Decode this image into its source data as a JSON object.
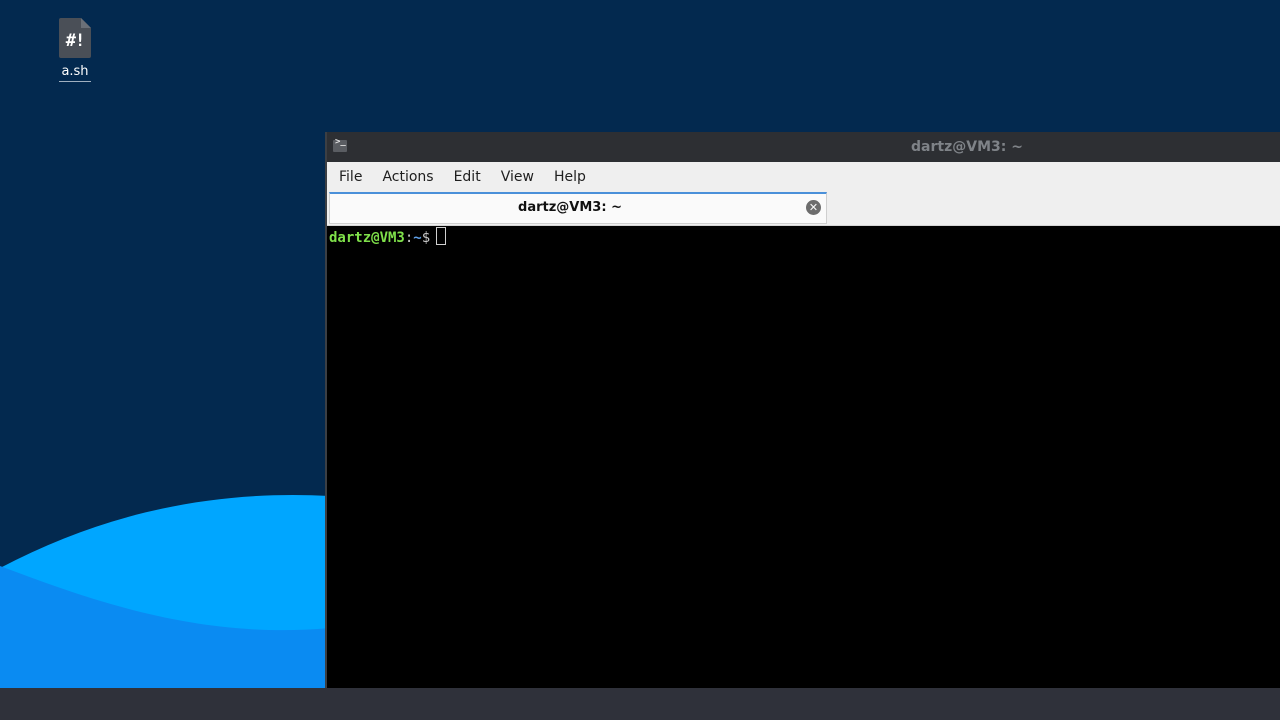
{
  "desktop": {
    "icons": [
      {
        "label": "a.sh",
        "glyph": "#!",
        "icon": "shell-script-file-icon"
      }
    ]
  },
  "window": {
    "title": "dartz@VM3: ~",
    "icon": "terminal-icon",
    "icon_glyph": ">_"
  },
  "menu": {
    "items": [
      "File",
      "Actions",
      "Edit",
      "View",
      "Help"
    ]
  },
  "tabs": [
    {
      "label": "dartz@VM3: ~",
      "close_icon": "close-icon",
      "close_glyph": "✕"
    }
  ],
  "terminal": {
    "user_host": "dartz@VM3",
    "separator": ":",
    "path": "~",
    "prompt_symbol": "$"
  },
  "colors": {
    "desktop_bg": "#03294f",
    "wave_light": "#00a2ff",
    "wave_dark": "#0a8ff0",
    "prompt_user": "#7fe04a",
    "prompt_path": "#5fa0e8",
    "tab_accent": "#4a90d9",
    "taskbar": "#2f313a"
  }
}
